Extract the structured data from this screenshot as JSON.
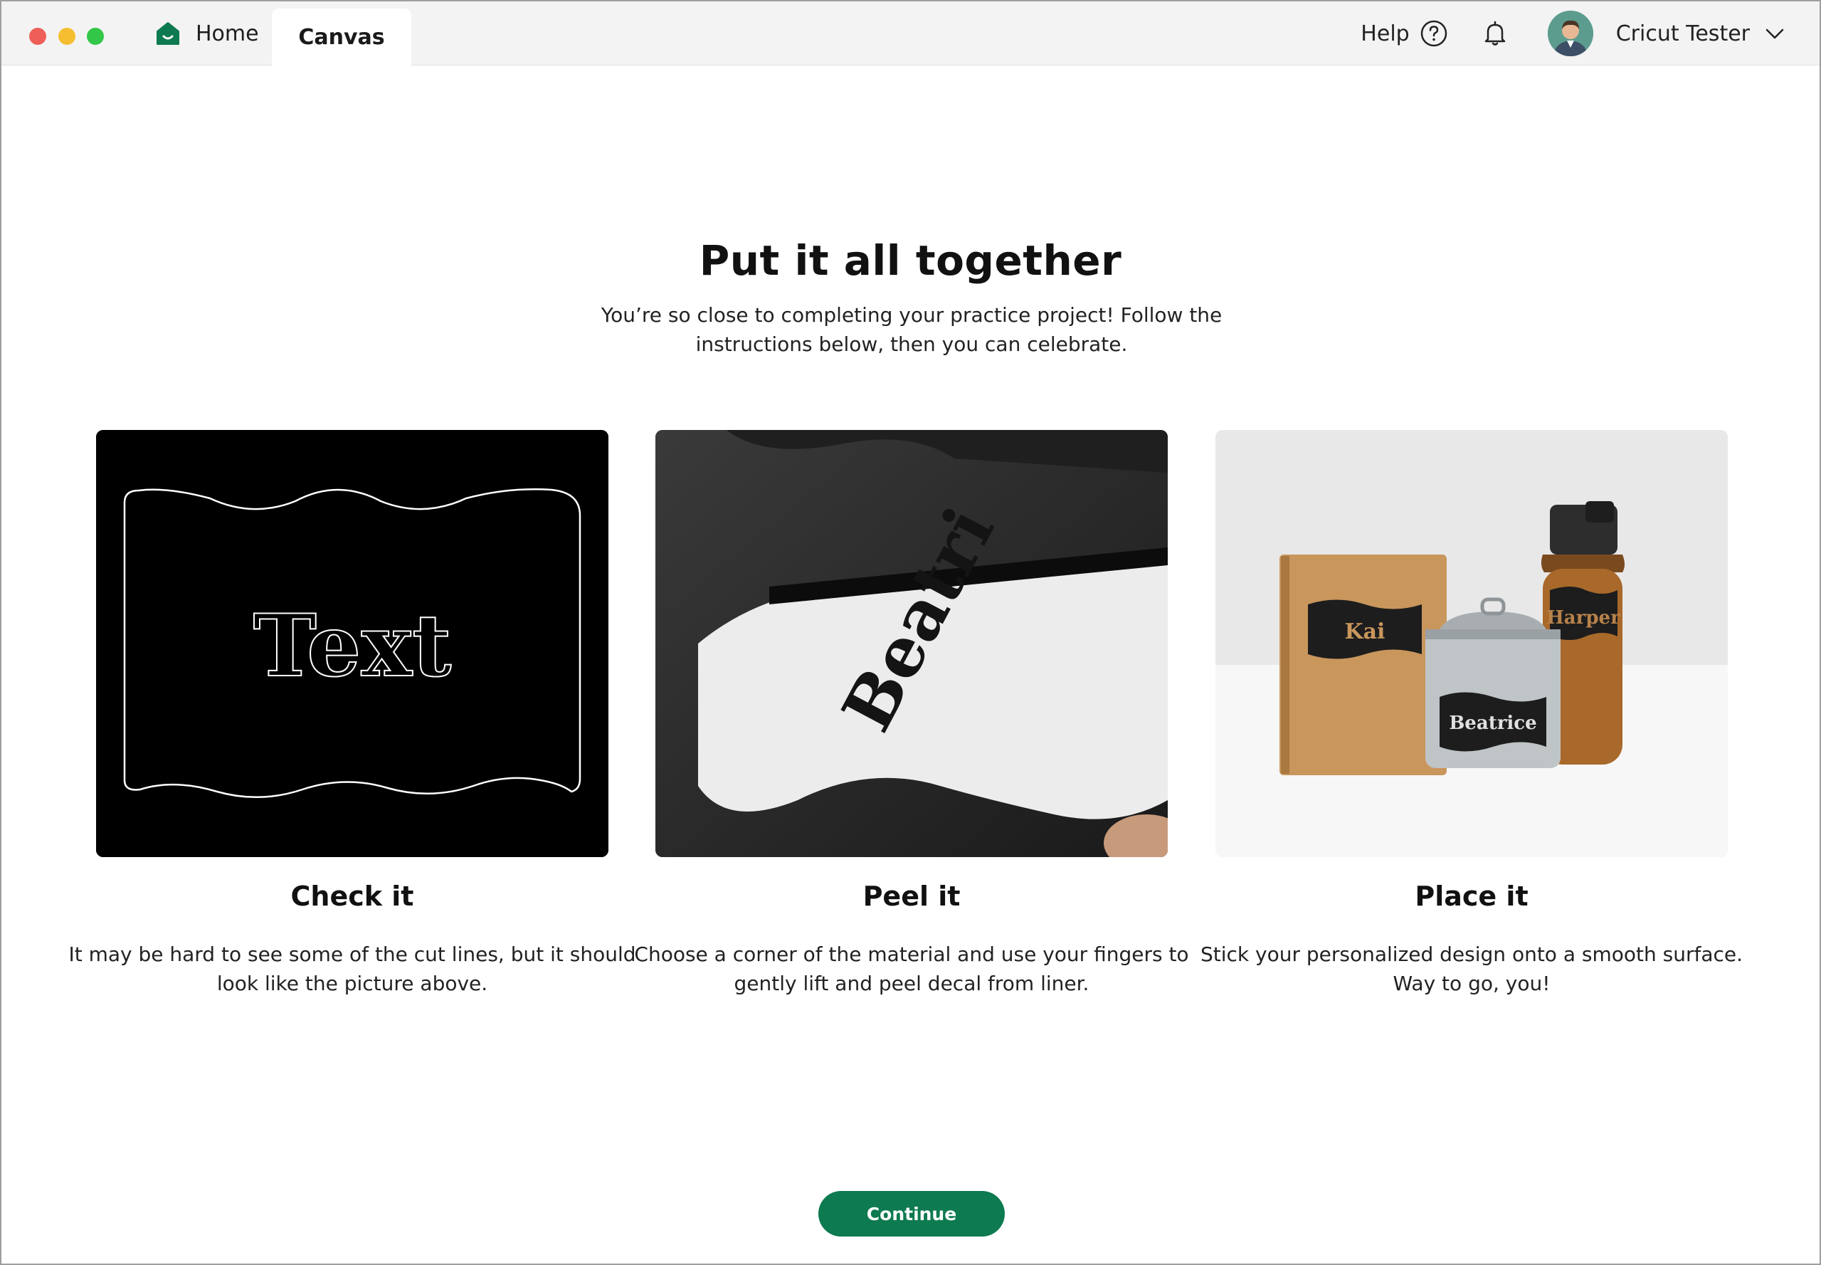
{
  "titlebar": {
    "tabs": [
      {
        "label": "Home",
        "icon": "home-icon",
        "active": false
      },
      {
        "label": "Canvas",
        "active": true
      }
    ],
    "help_label": "Help",
    "user_name": "Cricut Tester"
  },
  "main": {
    "title": "Put it all together",
    "subtitle": "You’re so close to completing your practice project! Follow the instructions below, then you can celebrate."
  },
  "steps": [
    {
      "title": "Check it",
      "description": "It may be hard to see some of the cut lines, but it should look like the picture above.",
      "image_text": "Text"
    },
    {
      "title": "Peel it",
      "description": "Choose a corner of the material and use your fingers to gently lift and peel decal from liner.",
      "image_text": "Beatri"
    },
    {
      "title": "Place it",
      "description": "Stick your personalized design onto a smooth surface. Way to go, you!",
      "image_labels": [
        "Kai",
        "Beatrice",
        "Harper"
      ]
    }
  ],
  "actions": {
    "continue_label": "Continue"
  },
  "colors": {
    "brand_green": "#0d7a4f",
    "titlebar_bg": "#f3f3f3"
  }
}
